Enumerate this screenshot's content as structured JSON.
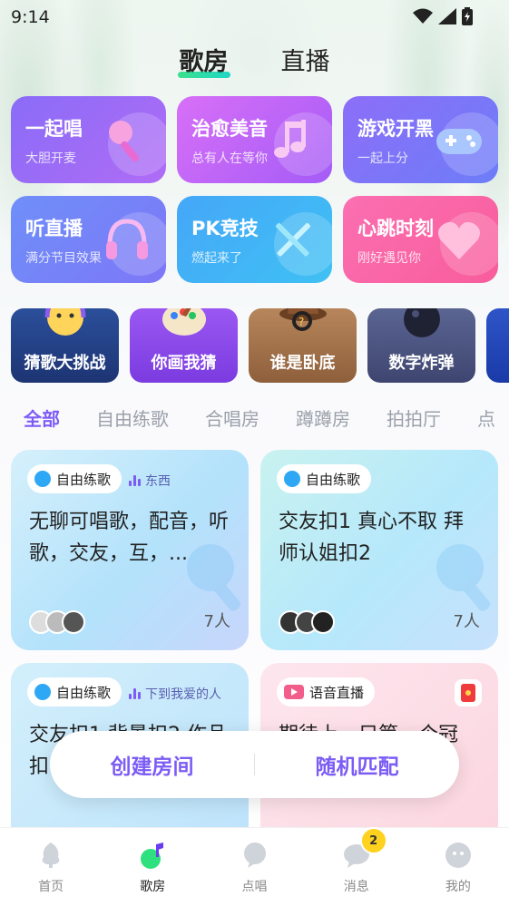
{
  "status_bar": {
    "time": "9:14"
  },
  "top_tabs": [
    {
      "label": "歌房",
      "active": true
    },
    {
      "label": "直播",
      "active": false
    }
  ],
  "features": [
    {
      "title": "一起唱",
      "subtitle": "大胆开麦",
      "icon": "microphone-icon"
    },
    {
      "title": "治愈美音",
      "subtitle": "总有人在等你",
      "icon": "music-note-icon"
    },
    {
      "title": "游戏开黑",
      "subtitle": "一起上分",
      "icon": "gamepad-icon"
    },
    {
      "title": "听直播",
      "subtitle": "满分节目效果",
      "icon": "headphones-icon"
    },
    {
      "title": "PK竞技",
      "subtitle": "燃起来了",
      "icon": "crossed-swords-icon"
    },
    {
      "title": "心跳时刻",
      "subtitle": "刚好遇见你",
      "icon": "heart-icon"
    }
  ],
  "games": [
    {
      "label": "猜歌大挑战",
      "icon": "guess-song-icon"
    },
    {
      "label": "你画我猜",
      "icon": "palette-icon"
    },
    {
      "label": "谁是卧底",
      "icon": "detective-hat-icon"
    },
    {
      "label": "数字炸弹",
      "icon": "bomb-icon"
    }
  ],
  "categories": [
    {
      "label": "全部",
      "active": true
    },
    {
      "label": "自由练歌",
      "active": false
    },
    {
      "label": "合唱房",
      "active": false
    },
    {
      "label": "蹲蹲房",
      "active": false
    },
    {
      "label": "拍拍厅",
      "active": false
    },
    {
      "label": "点",
      "active": false
    }
  ],
  "rooms": [
    {
      "tag": "自由练歌",
      "host": "东西",
      "title": "无聊可唱歌，配音，听歌，交友，互，...",
      "count": "7人"
    },
    {
      "tag": "自由练歌",
      "host": "",
      "title": "交友扣1 真心不取 拜师认姐扣2",
      "count": "7人"
    },
    {
      "tag": "自由练歌",
      "host": "下到我爱的人",
      "title": "交友扣1 背景扣2 作品扣",
      "count": ""
    },
    {
      "tag": "语音直播",
      "host": "",
      "title": "期待上一只第一个冠",
      "count": ""
    }
  ],
  "float_actions": {
    "create": "创建房间",
    "random": "随机匹配"
  },
  "bottom_nav": [
    {
      "label": "首页",
      "icon": "tree-icon",
      "active": false
    },
    {
      "label": "歌房",
      "icon": "music-room-icon",
      "active": true
    },
    {
      "label": "点唱",
      "icon": "mic-bubble-icon",
      "active": false
    },
    {
      "label": "消息",
      "icon": "message-icon",
      "active": false,
      "badge": "2"
    },
    {
      "label": "我的",
      "icon": "profile-icon",
      "active": false
    }
  ],
  "colors": {
    "accent": "#7d5cf6",
    "tab_underline": "#3be08b",
    "badge": "#ffd21f"
  }
}
